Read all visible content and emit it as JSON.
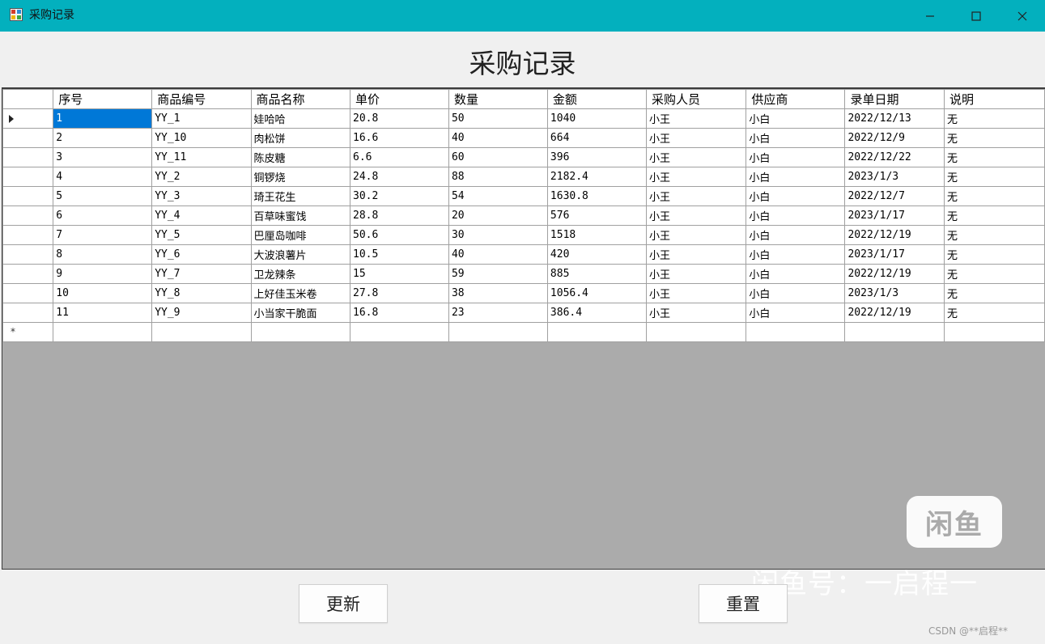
{
  "window": {
    "title": "采购记录",
    "controls": {
      "minimize_icon": "minimize-icon",
      "maximize_icon": "maximize-icon",
      "close_icon": "close-icon"
    },
    "titlebar_color": "#03b0be"
  },
  "form": {
    "heading": "采购记录"
  },
  "grid": {
    "columns": [
      "序号",
      "商品编号",
      "商品名称",
      "单价",
      "数量",
      "金额",
      "采购人员",
      "供应商",
      "录单日期",
      "说明"
    ],
    "rows": [
      [
        "1",
        "YY_1",
        "娃哈哈",
        "20.8",
        "50",
        "1040",
        "小王",
        "小白",
        "2022/12/13",
        "无"
      ],
      [
        "2",
        "YY_10",
        "肉松饼",
        "16.6",
        "40",
        "664",
        "小王",
        "小白",
        "2022/12/9",
        "无"
      ],
      [
        "3",
        "YY_11",
        "陈皮糖",
        "6.6",
        "60",
        "396",
        "小王",
        "小白",
        "2022/12/22",
        "无"
      ],
      [
        "4",
        "YY_2",
        "铜锣烧",
        "24.8",
        "88",
        "2182.4",
        "小王",
        "小白",
        "2023/1/3",
        "无"
      ],
      [
        "5",
        "YY_3",
        "琦王花生",
        "30.2",
        "54",
        "1630.8",
        "小王",
        "小白",
        "2022/12/7",
        "无"
      ],
      [
        "6",
        "YY_4",
        "百草味蜜饯",
        "28.8",
        "20",
        "576",
        "小王",
        "小白",
        "2023/1/17",
        "无"
      ],
      [
        "7",
        "YY_5",
        "巴厘岛咖啡",
        "50.6",
        "30",
        "1518",
        "小王",
        "小白",
        "2022/12/19",
        "无"
      ],
      [
        "8",
        "YY_6",
        "大波浪薯片",
        "10.5",
        "40",
        "420",
        "小王",
        "小白",
        "2023/1/17",
        "无"
      ],
      [
        "9",
        "YY_7",
        "卫龙辣条",
        "15",
        "59",
        "885",
        "小王",
        "小白",
        "2022/12/19",
        "无"
      ],
      [
        "10",
        "YY_8",
        "上好佳玉米卷",
        "27.8",
        "38",
        "1056.4",
        "小王",
        "小白",
        "2023/1/3",
        "无"
      ],
      [
        "11",
        "YY_9",
        "小当家干脆面",
        "16.8",
        "23",
        "386.4",
        "小王",
        "小白",
        "2022/12/19",
        "无"
      ]
    ],
    "new_row_marker": "*",
    "selected_accent": "#0078d7"
  },
  "buttons": {
    "update_label": "更新",
    "reset_label": "重置"
  },
  "watermark": {
    "logo_text": "闲鱼",
    "text": "闲鱼号：一启程一",
    "csdn": "CSDN @**启程**"
  }
}
